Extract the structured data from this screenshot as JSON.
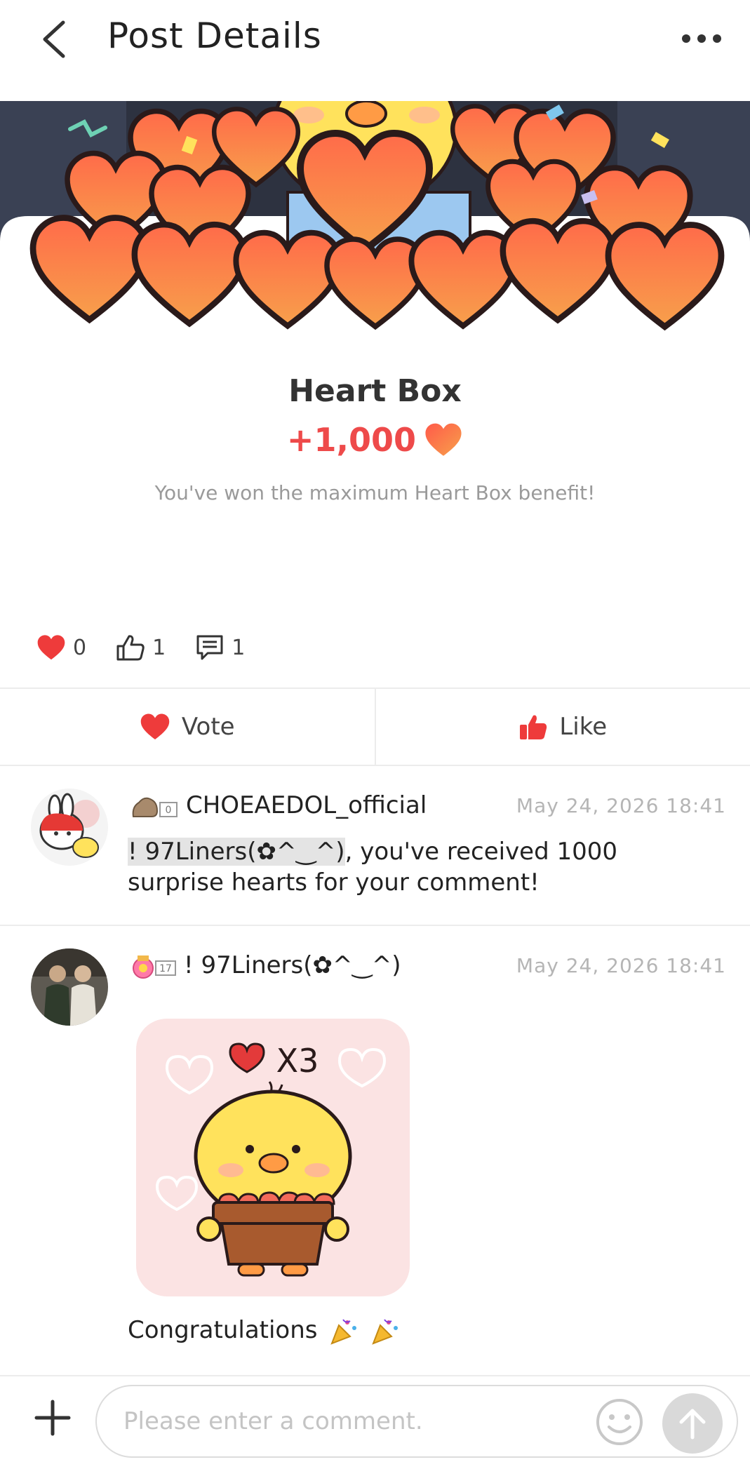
{
  "header": {
    "title": "Post Details",
    "back_icon": "chevron-left-icon",
    "more_icon": "more-horizontal-icon"
  },
  "heart_box": {
    "title": "Heart Box",
    "amount": "+1,000",
    "description": "You've won the maximum Heart Box benefit!"
  },
  "stats": {
    "hearts": "0",
    "likes": "1",
    "comments": "1"
  },
  "actions": {
    "vote_label": "Vote",
    "like_label": "Like"
  },
  "comments": [
    {
      "badge_level": "0",
      "author": "CHOEAEDOL_official",
      "time": "May 24, 2026 18:41",
      "mention": "!       97Liners(✿^‿^)",
      "text_after": ", you've received 1000 surprise hearts for your comment!"
    },
    {
      "badge_level": "17",
      "author": "!       97Liners(✿^‿^)",
      "time": "May 24, 2026 18:41",
      "sticker_text": "X3",
      "text": "Congratulations"
    }
  ],
  "composer": {
    "placeholder": "Please enter a comment."
  },
  "colors": {
    "accent_red": "#ee4a4a",
    "muted_text": "#9a9a9a",
    "divider": "#ececec"
  }
}
